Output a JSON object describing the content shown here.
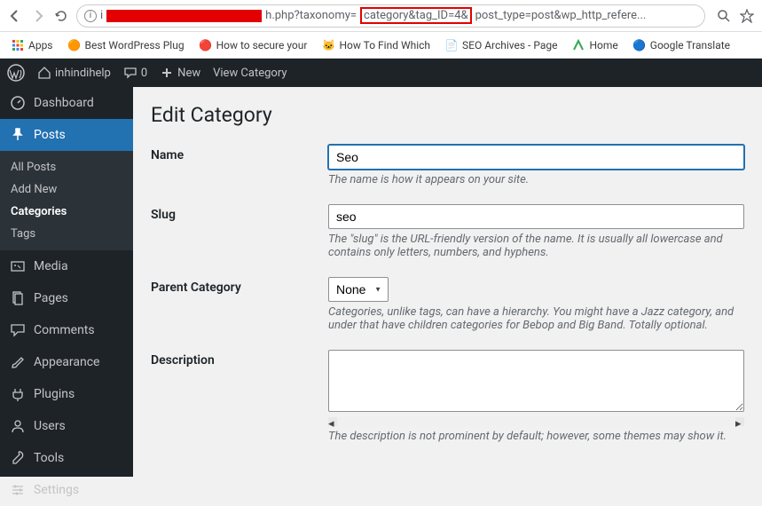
{
  "browser": {
    "url_prefix": "i",
    "url_mid": "h.php?taxonomy=",
    "url_highlight": "category&tag_ID=4&",
    "url_suffix": "post_type=post&wp_http_refere..."
  },
  "bookmarks": {
    "apps": "Apps",
    "items": [
      "Best WordPress Plug",
      "How to secure your",
      "How To Find Which",
      "SEO Archives - Page",
      "Home",
      "Google Translate"
    ]
  },
  "adminbar": {
    "site": "inhindihelp",
    "comments": "0",
    "new": "New",
    "view": "View Category"
  },
  "sidebar": {
    "dashboard": "Dashboard",
    "posts": "Posts",
    "posts_sub": [
      "All Posts",
      "Add New",
      "Categories",
      "Tags"
    ],
    "media": "Media",
    "pages": "Pages",
    "comments": "Comments",
    "appearance": "Appearance",
    "plugins": "Plugins",
    "users": "Users",
    "tools": "Tools",
    "settings": "Settings"
  },
  "page": {
    "title": "Edit Category",
    "name_label": "Name",
    "name_value": "Seo",
    "name_desc": "The name is how it appears on your site.",
    "slug_label": "Slug",
    "slug_value": "seo",
    "slug_desc": "The \"slug\" is the URL-friendly version of the name. It is usually all lowercase and contains only letters, numbers, and hyphens.",
    "parent_label": "Parent Category",
    "parent_value": "None",
    "parent_desc": "Categories, unlike tags, can have a hierarchy. You might have a Jazz category, and under that have children categories for Bebop and Big Band. Totally optional.",
    "desc_label": "Description",
    "desc_desc": "The description is not prominent by default; however, some themes may show it."
  }
}
